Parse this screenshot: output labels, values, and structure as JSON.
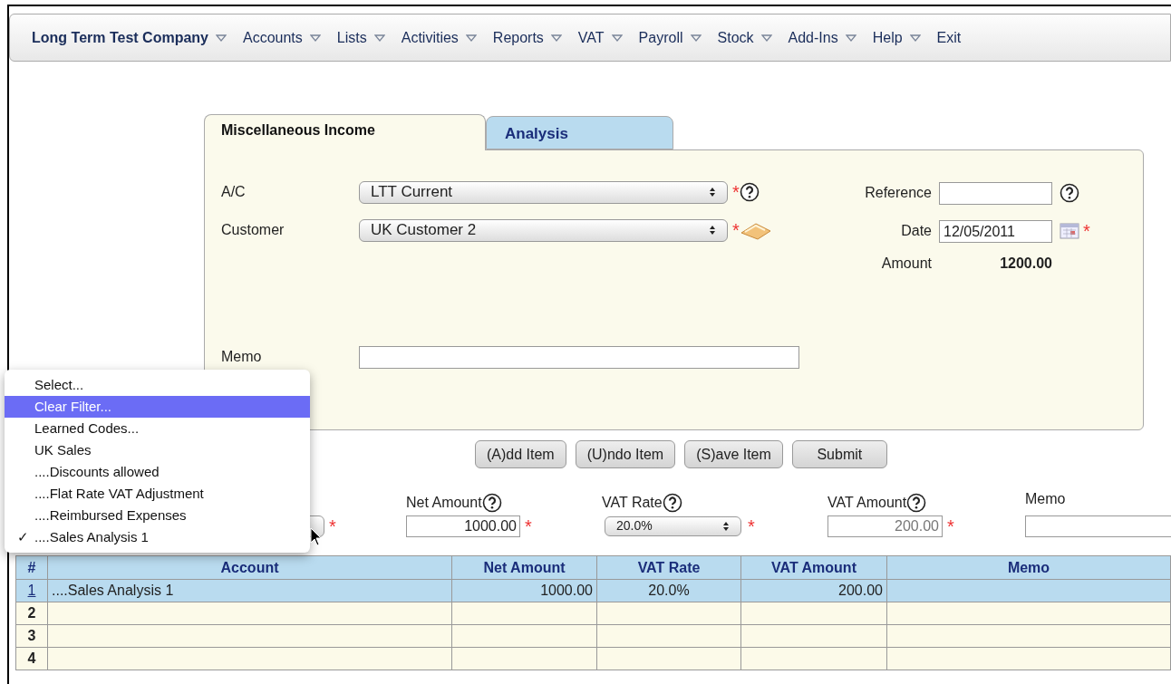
{
  "menu_bar": {
    "items": [
      {
        "label": "Long Term Test Company",
        "dropdown": true,
        "bold": true
      },
      {
        "label": "Accounts",
        "dropdown": true,
        "bold": false
      },
      {
        "label": "Lists",
        "dropdown": true,
        "bold": false
      },
      {
        "label": "Activities",
        "dropdown": true,
        "bold": false
      },
      {
        "label": "Reports",
        "dropdown": true,
        "bold": false
      },
      {
        "label": "VAT",
        "dropdown": true,
        "bold": false
      },
      {
        "label": "Payroll",
        "dropdown": true,
        "bold": false
      },
      {
        "label": "Stock",
        "dropdown": true,
        "bold": false
      },
      {
        "label": "Add-Ins",
        "dropdown": true,
        "bold": false
      },
      {
        "label": "Help",
        "dropdown": true,
        "bold": false
      },
      {
        "label": "Exit",
        "dropdown": false,
        "bold": false
      }
    ]
  },
  "tabs": [
    {
      "label": "Miscellaneous Income",
      "selected": true
    },
    {
      "label": "Analysis",
      "selected": false
    }
  ],
  "form": {
    "ac": {
      "label": "A/C",
      "value": "LTT Current",
      "required_mark": "*"
    },
    "customer": {
      "label": "Customer",
      "value": "UK Customer 2",
      "required_mark": "*"
    },
    "memo": {
      "label": "Memo"
    },
    "reference": {
      "label": "Reference"
    },
    "date": {
      "label": "Date",
      "value": "12/05/2011",
      "required_mark": "*"
    },
    "amount": {
      "label": "Amount",
      "value": "1200.00"
    }
  },
  "buttons": [
    "(A)dd Item",
    "(U)ndo Item",
    "(S)ave Item",
    "Submit"
  ],
  "line_entry": {
    "account": {
      "required_mark": "*"
    },
    "net_amount": {
      "label": "Net Amount",
      "value": "1000.00",
      "required_mark": "*"
    },
    "vat_rate": {
      "label": "VAT Rate",
      "value": "20.0%",
      "required_mark": "*"
    },
    "vat_amount": {
      "label": "VAT Amount",
      "value": "200.00",
      "disabled": true,
      "required_mark": "*"
    },
    "memo": {
      "label": "Memo"
    }
  },
  "account_dropdown": {
    "items": [
      {
        "label": "Select...",
        "selected": false
      },
      {
        "label": "Clear Filter...",
        "selected": true
      },
      {
        "label": "Learned Codes...",
        "selected": false
      },
      {
        "label": "UK Sales",
        "selected": false
      },
      {
        "label": "....Discounts allowed",
        "selected": false
      },
      {
        "label": "....Flat Rate VAT Adjustment",
        "selected": false
      },
      {
        "label": "....Reimbursed Expenses",
        "selected": false
      },
      {
        "label": "....Sales Analysis 1",
        "selected": false,
        "check_mark": "✓"
      }
    ]
  },
  "table": {
    "columns": [
      "#",
      "Account",
      "Net Amount",
      "VAT Rate",
      "VAT Amount",
      "Memo"
    ],
    "rows": [
      {
        "selected": true,
        "cells": [
          "1",
          "....Sales Analysis 1",
          "1000.00",
          "20.0%",
          "200.00"
        ]
      },
      {
        "selected": false,
        "cells": [
          "2"
        ]
      },
      {
        "selected": false,
        "cells": [
          "3"
        ]
      },
      {
        "selected": false,
        "cells": [
          "4"
        ]
      }
    ]
  }
}
